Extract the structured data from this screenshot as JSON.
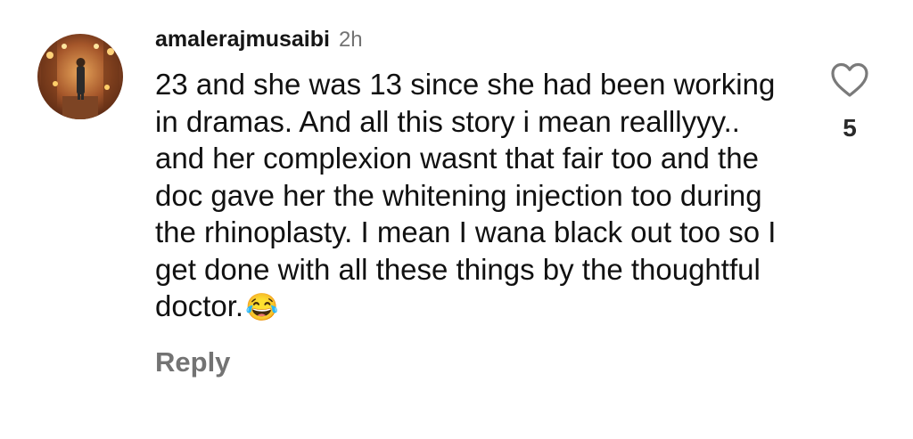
{
  "comment": {
    "username": "amalerajmusaibi",
    "timestamp": "2h",
    "text": "23 and she was 13 since she had been working in dramas. And all this story i mean realllyyy.. and her complexion wasnt that fair too and the doc gave her the whitening injection too during the rhinoplasty. I mean I wana black out too so I get done with all these things by the thoughtful doctor.",
    "emoji": "😂",
    "reply_label": "Reply",
    "like_count": "5",
    "like_icon": "heart-outline-icon"
  },
  "colors": {
    "username": "#161616",
    "secondary_text": "#737373",
    "body_text": "#111111",
    "background": "#ffffff"
  }
}
